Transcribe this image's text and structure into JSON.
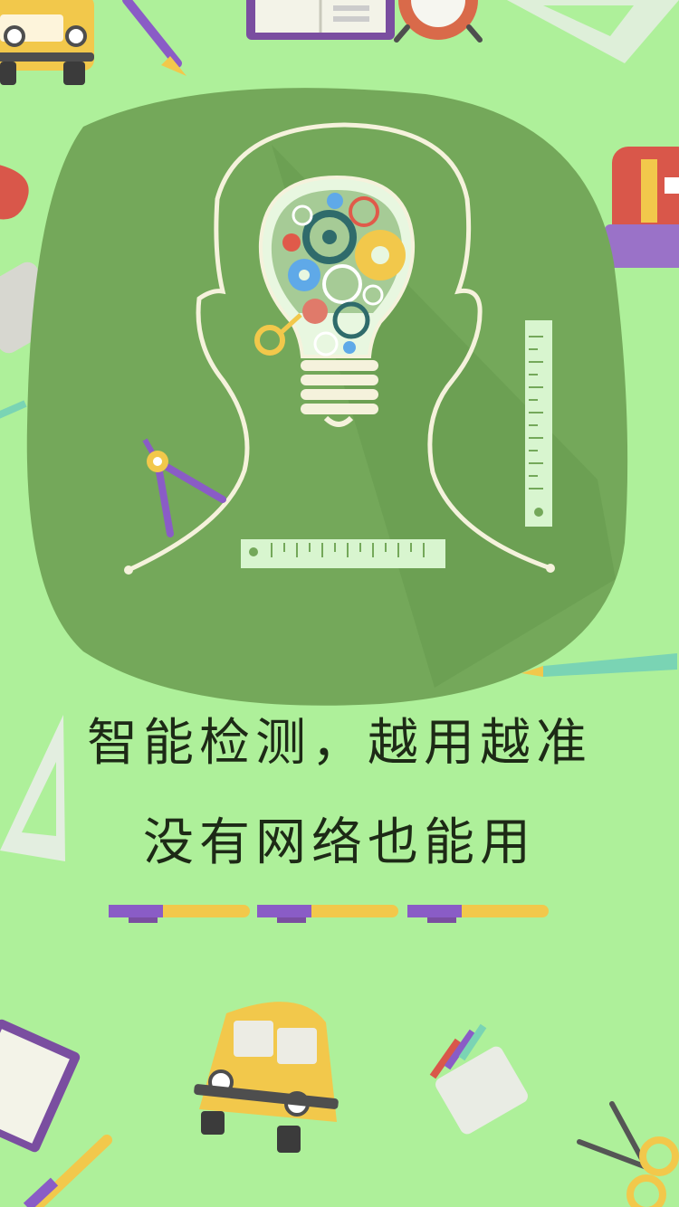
{
  "screen": {
    "background": "#aef09a",
    "blob_color": "#74a85a",
    "accent_yellow": "#f2c84b",
    "accent_purple": "#8a5cc6"
  },
  "headline": {
    "line1": "智能检测，越用越准",
    "line2": "没有网络也能用"
  },
  "pager": {
    "count": 3,
    "active_index": 0
  },
  "icons": [
    "lightbulb-icon",
    "head-outline-icon",
    "gear-icon",
    "ruler-icon",
    "compass-icon",
    "pencil-icon",
    "school-bus-icon",
    "book-icon",
    "alarm-clock-icon",
    "set-square-icon",
    "scissors-icon",
    "pencil-cup-icon",
    "backpack-icon"
  ]
}
